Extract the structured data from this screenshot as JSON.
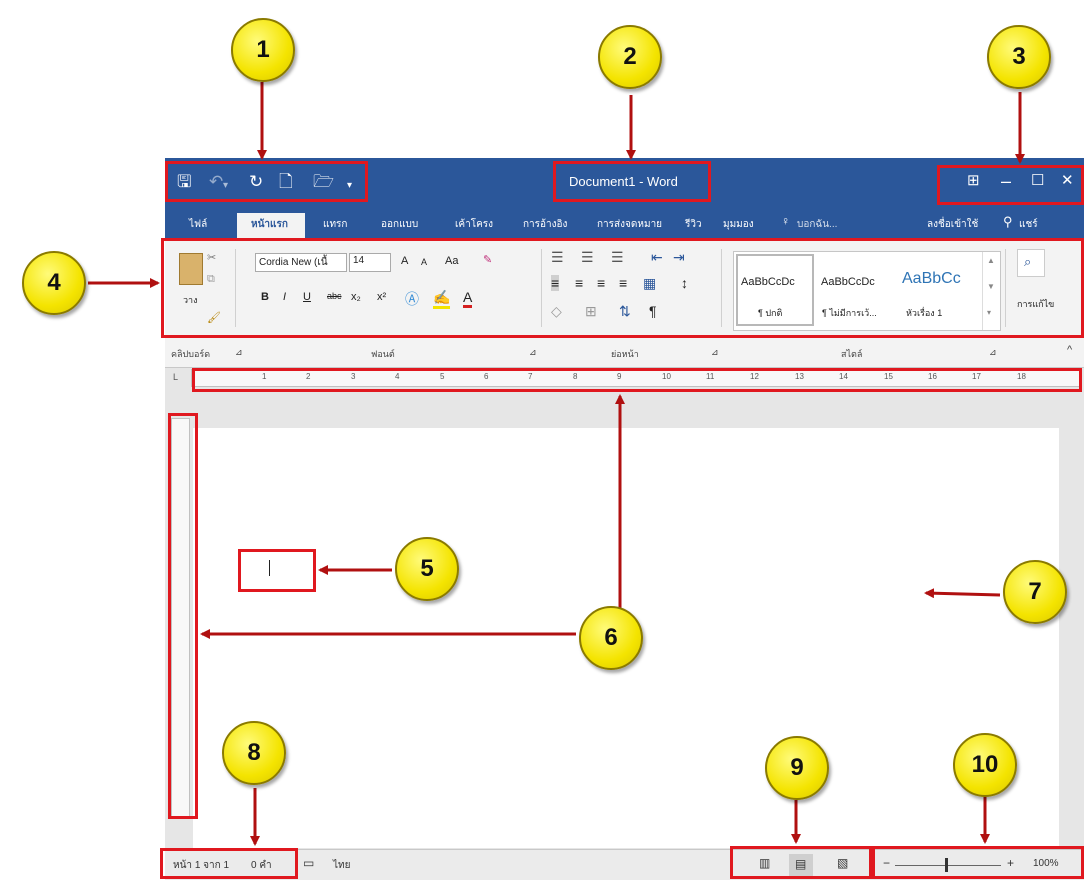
{
  "window": {
    "title": "Document1 - Word",
    "quick_access": {
      "save_icon": "save-icon",
      "undo_icon": "undo-icon",
      "redo_icon": "redo-icon",
      "new_icon": "new-document-icon",
      "open_icon": "open-folder-icon",
      "customize_icon": "customize-qat-icon"
    },
    "controls": {
      "ribbon_display": "⊞",
      "minimize": "–",
      "maximize": "☐",
      "close": "✕"
    }
  },
  "tabs": [
    "ไฟล์",
    "หน้าแรก",
    "แทรก",
    "ออกแบบ",
    "เค้าโครง",
    "การอ้างอิง",
    "การส่งจดหมาย",
    "รีวิว",
    "มุมมอง",
    "บอกฉัน...",
    "ลงชื่อเข้าใช้",
    "แชร์"
  ],
  "ribbon": {
    "clipboard": {
      "paste_label": "วาง",
      "group_label": "คลิปบอร์ด"
    },
    "font": {
      "name": "Cordia New (เนื้",
      "size": "14",
      "group_label": "ฟอนต์",
      "bold": "B",
      "italic": "I",
      "underline": "U",
      "strike": "abc",
      "subscript": "x₂",
      "superscript": "x²",
      "grow": "A",
      "shrink": "A",
      "case": "Aa"
    },
    "paragraph": {
      "group_label": "ย่อหน้า",
      "pilcrow": "¶"
    },
    "styles": {
      "group_label": "สไตล์",
      "items": [
        {
          "preview": "AaBbCcDc",
          "name": "¶ ปกติ"
        },
        {
          "preview": "AaBbCcDc",
          "name": "¶ ไม่มีการเว้...",
          "active": false
        },
        {
          "preview": "AaBbCc",
          "name": "หัวเรื่อง 1"
        }
      ]
    },
    "editing": {
      "label": "การแก้ไข"
    }
  },
  "ruler": {
    "marks": [
      "1",
      "2",
      "3",
      "4",
      "5",
      "6",
      "7",
      "8",
      "9",
      "10",
      "11",
      "12",
      "13",
      "14",
      "15",
      "16",
      "17",
      "18"
    ]
  },
  "status": {
    "page": "หน้า 1 จาก 1",
    "words": "0 คำ",
    "language": "ไทย",
    "zoom": "100%"
  },
  "callouts": [
    "1",
    "2",
    "3",
    "4",
    "5",
    "6",
    "7",
    "8",
    "9",
    "10"
  ],
  "colors": {
    "word_blue": "#2b579a",
    "annotation_red": "#e0181f",
    "callout_yellow": "#f4e400"
  }
}
